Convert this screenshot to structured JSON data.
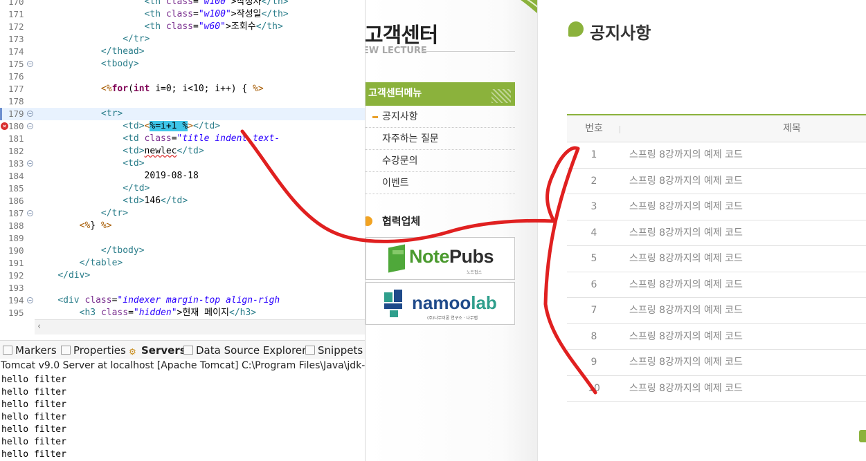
{
  "editor": {
    "lines": [
      {
        "n": "170",
        "html": "                    <span class='tag'>&lt;th</span> <span class='attr'>class</span>=<span class='str'>\"w100\"</span>&gt;작성자<span class='tag'>&lt;/th&gt;</span>"
      },
      {
        "n": "171",
        "html": "                    <span class='tag'>&lt;th</span> <span class='attr'>class</span>=<span class='str'>\"w100\"</span>&gt;작성일<span class='tag'>&lt;/th&gt;</span>"
      },
      {
        "n": "172",
        "html": "                    <span class='tag'>&lt;th</span> <span class='attr'>class</span>=<span class='str'>\"w60\"</span>&gt;조회수<span class='tag'>&lt;/th&gt;</span>"
      },
      {
        "n": "173",
        "html": "                <span class='tag'>&lt;/tr&gt;</span>"
      },
      {
        "n": "174",
        "html": "            <span class='tag'>&lt;/thead&gt;</span>"
      },
      {
        "n": "175",
        "fold": true,
        "html": "            <span class='tag'>&lt;tbody&gt;</span>"
      },
      {
        "n": "176",
        "html": ""
      },
      {
        "n": "177",
        "html": "            <span class='jsp'>&lt;%</span><span class='kw'>for</span>(<span class='kw'>int</span> i=0; i&lt;10; i++) { <span class='jsp'>%&gt;</span>"
      },
      {
        "n": "178",
        "html": ""
      },
      {
        "n": "179",
        "fold": true,
        "marker": true,
        "hl": true,
        "html": "            <span class='tag'>&lt;tr&gt;</span>"
      },
      {
        "n": "180",
        "fold": true,
        "err": true,
        "html": "                <span class='tag'>&lt;td&gt;</span><span class='jsp'>&lt;</span><span class='sel'>%=i+1 %</span><span class='jsp'>&gt;</span><span class='tag'>&lt;/td&gt;</span>"
      },
      {
        "n": "181",
        "html": "                <span class='tag'>&lt;td</span> <span class='attr'>class</span>=<span class='str'>\"title indent text-</span>"
      },
      {
        "n": "182",
        "html": "                <span class='tag'>&lt;td&gt;</span><span class='squig'>newlec</span><span class='tag'>&lt;/td&gt;</span>"
      },
      {
        "n": "183",
        "fold": true,
        "html": "                <span class='tag'>&lt;td&gt;</span>"
      },
      {
        "n": "184",
        "html": "                    2019-08-18"
      },
      {
        "n": "185",
        "html": "                <span class='tag'>&lt;/td&gt;</span>"
      },
      {
        "n": "186",
        "html": "                <span class='tag'>&lt;td&gt;</span>146<span class='tag'>&lt;/td&gt;</span>"
      },
      {
        "n": "187",
        "fold": true,
        "html": "            <span class='tag'>&lt;/tr&gt;</span>"
      },
      {
        "n": "188",
        "html": "        <span class='jsp'>&lt;%</span>} <span class='jsp'>%&gt;</span>"
      },
      {
        "n": "189",
        "html": ""
      },
      {
        "n": "190",
        "html": "            <span class='tag'>&lt;/tbody&gt;</span>"
      },
      {
        "n": "191",
        "html": "        <span class='tag'>&lt;/table&gt;</span>"
      },
      {
        "n": "192",
        "html": "    <span class='tag'>&lt;/div&gt;</span>"
      },
      {
        "n": "193",
        "html": ""
      },
      {
        "n": "194",
        "fold": true,
        "html": "    <span class='tag'>&lt;div</span> <span class='attr'>class</span>=<span class='str'>\"indexer margin-top align-righ</span>"
      },
      {
        "n": "195",
        "html": "        <span class='tag'>&lt;h3</span> <span class='attr'>class</span>=<span class='str'>\"hidden\"</span>&gt;현재 페이지<span class='tag'>&lt;/h3&gt;</span>"
      }
    ]
  },
  "panel": {
    "tabs": [
      {
        "label": "Markers",
        "icon": "markers-icon"
      },
      {
        "label": "Properties",
        "icon": "properties-icon"
      },
      {
        "label": "Servers",
        "icon": "servers-icon",
        "active": true
      },
      {
        "label": "Data Source Explorer",
        "icon": "data-source-icon"
      },
      {
        "label": "Snippets",
        "icon": "snippets-icon"
      }
    ],
    "console_title": "Tomcat v9.0 Server at localhost [Apache Tomcat] C:\\Program Files\\Java\\jdk-",
    "console_lines": [
      "hello filter",
      "hello filter",
      "hello filter",
      "hello filter",
      "hello filter",
      "hello filter",
      "hello filter"
    ]
  },
  "site": {
    "title": "고객센터",
    "subtitle": "EW LECTURE",
    "menu_header": "고객센터메뉴",
    "menu_items": [
      "공지사항",
      "자주하는 질문",
      "수강문의",
      "이벤트"
    ],
    "partner_title": "협력업체",
    "partner_notepubs": {
      "brand": "Note",
      "brand2": "Pubs",
      "tagline": "노트펍스"
    },
    "partner_namoolab": {
      "brand": "namoo",
      "brand2": "lab",
      "tagline": "(주)나무이론 연구소 · 나무랩"
    }
  },
  "notice": {
    "title": "공지사항",
    "col_num": "번호",
    "col_title": "제목",
    "rows": [
      {
        "num": "1",
        "title": "스프링 8강까지의 예제 코드"
      },
      {
        "num": "2",
        "title": "스프링 8강까지의 예제 코드"
      },
      {
        "num": "3",
        "title": "스프링 8강까지의 예제 코드"
      },
      {
        "num": "4",
        "title": "스프링 8강까지의 예제 코드"
      },
      {
        "num": "5",
        "title": "스프링 8강까지의 예제 코드"
      },
      {
        "num": "6",
        "title": "스프링 8강까지의 예제 코드"
      },
      {
        "num": "7",
        "title": "스프링 8강까지의 예제 코드"
      },
      {
        "num": "8",
        "title": "스프링 8강까지의 예제 코드"
      },
      {
        "num": "9",
        "title": "스프링 8강까지의 예제 코드"
      },
      {
        "num": "10",
        "title": "스프링 8강까지의 예제 코드"
      }
    ]
  },
  "colors": {
    "accent_green": "#8bb23c",
    "annotation_red": "#e02020",
    "selection": "#3fc6e9"
  }
}
